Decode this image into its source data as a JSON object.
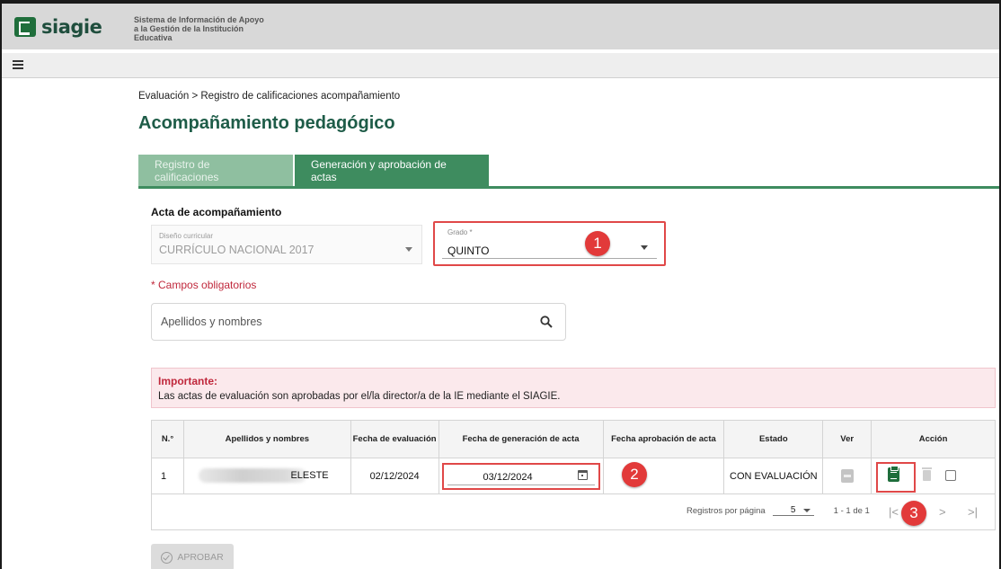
{
  "app": {
    "brand": "siagie",
    "tagline": "Sistema de Información de Apoyo a la Gestión de la Institución Educativa"
  },
  "breadcrumb": "Evaluación > Registro de calificaciones acompañamiento",
  "page_title": "Acompañamiento pedagógico",
  "tabs": [
    {
      "label": "Registro de calificaciones",
      "active": false
    },
    {
      "label": "Generación y aprobación de actas",
      "active": true
    }
  ],
  "section_title": "Acta de acompañamiento",
  "fields": {
    "diseno": {
      "label": "Diseño curricular",
      "value": "CURRÍCULO NACIONAL 2017"
    },
    "grado": {
      "label": "Grado *",
      "value": "QUINTO"
    }
  },
  "required_note": "* Campos obligatorios",
  "search": {
    "placeholder": "Apellidos y nombres"
  },
  "alert": {
    "title": "Importante:",
    "text": "Las actas de evaluación son aprobadas por el/la director/a de la IE mediante el SIAGIE."
  },
  "table": {
    "headers": [
      "N.°",
      "Apellidos y nombres",
      "Fecha de evaluación",
      "Fecha de generación de acta",
      "Fecha aprobación de acta",
      "Estado",
      "Ver",
      "Acción"
    ],
    "rows": [
      {
        "num": "1",
        "name": "ELESTE",
        "fecha_eval": "02/12/2024",
        "fecha_gen": "03/12/2024",
        "fecha_aprob": "",
        "estado": "CON EVALUACIÓN"
      }
    ]
  },
  "pagination": {
    "label": "Registros por página",
    "per_page": "5",
    "range": "1 - 1 de 1"
  },
  "approve_button": "APROBAR",
  "callouts": [
    "1",
    "2",
    "3"
  ],
  "colors": {
    "brand_green": "#1f6e3b",
    "tab_active": "#3e8c5f",
    "title_green": "#1e5c48",
    "required_red": "#c0283c",
    "callout_red": "#e23a3a"
  }
}
